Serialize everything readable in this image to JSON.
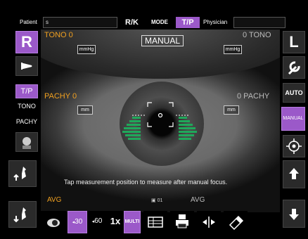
{
  "topbar": {
    "patient_label": "Patient",
    "patient_value": "s",
    "rk_label": "R/K",
    "mode_label": "MODE",
    "tp_label": "T/P",
    "physician_label": "Physician",
    "physician_value": ""
  },
  "left_panel": {
    "eye_label": "R",
    "tp_label": "T/P",
    "tono_label": "TONO",
    "pachy_label": "PACHY"
  },
  "right_panel": {
    "eye_label": "L",
    "auto_label": "AUTO",
    "manual_label": "MANUAL"
  },
  "camera": {
    "tono_left": "TONO 0",
    "tono_right": "0 TONO",
    "unit_mmhg": "mmHg",
    "manual_label": "MANUAL",
    "pachy_left": "PACHY 0",
    "pachy_right": "0 PACHY",
    "unit_mm": "mm",
    "instruction": "Tap measurement position to measure after manual focus."
  },
  "bottom": {
    "avg_left": "AVG",
    "avg_right": "AVG",
    "count_label": "01",
    "btn_30": "30",
    "btn_60": "60",
    "btn_1x": "1x",
    "btn_multi": "MULTI"
  },
  "colors": {
    "accent_purple": "#9b59c9",
    "value_orange": "#f0a020",
    "alignment_green": "#1fa85a"
  }
}
